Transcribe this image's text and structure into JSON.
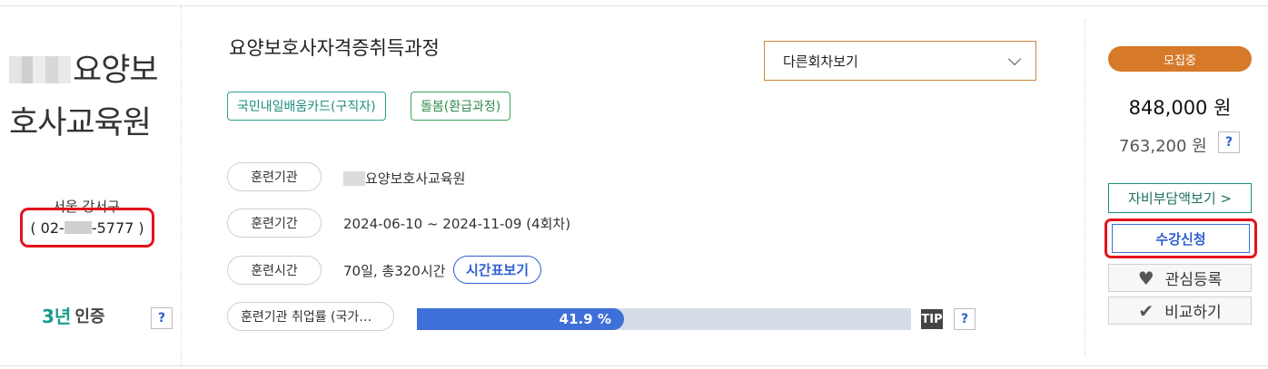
{
  "institution": {
    "name_line1": "요양보",
    "name_line2": "호사교육원",
    "region": "서울 강서구",
    "phone_prefix": "( 02-",
    "phone_suffix": "-5777 )",
    "cert_num": "3년",
    "cert_label": "인증",
    "help": "?"
  },
  "course": {
    "title": "요양보호사자격증취득과정",
    "other_round": "다른회차보기",
    "tags": [
      "국민내일배움카드(구직자)",
      "돌봄(환급과정)"
    ],
    "rows": [
      {
        "label": "훈련기관",
        "value": "요양보호사교육원"
      },
      {
        "label": "훈련기간",
        "value": "2024-06-10 ~ 2024-11-09 (4회차)"
      },
      {
        "label": "훈련시간",
        "value": "70일, 총320시간"
      }
    ],
    "timetable_btn": "시간표보기",
    "employment_label": "훈련기관 취업률 (국가…",
    "employment_rate": 41.9,
    "employment_text": "41.9 %",
    "tip": "TIP",
    "help": "?"
  },
  "pricing": {
    "status": "모집중",
    "price": "848,000 원",
    "support_price": "763,200 원",
    "help": "?",
    "self_pay_btn": "자비부담액보기 >",
    "apply_btn": "수강신청",
    "wish_btn": "관심등록",
    "compare_btn": "비교하기"
  },
  "colors": {
    "accent_blue": "#3f6fd8",
    "teal": "#1e8d7c",
    "status_orange": "#d67a2a",
    "highlight_red": "#e4131b"
  }
}
